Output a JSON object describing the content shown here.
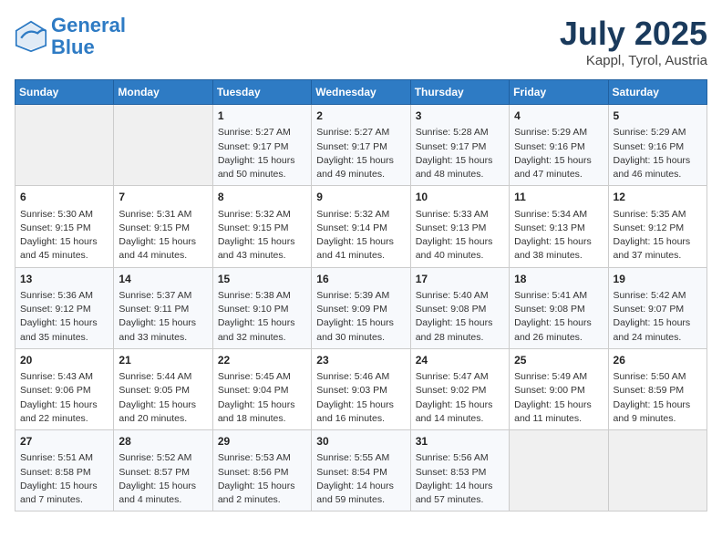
{
  "header": {
    "logo_line1": "General",
    "logo_line2": "Blue",
    "month": "July 2025",
    "location": "Kappl, Tyrol, Austria"
  },
  "weekdays": [
    "Sunday",
    "Monday",
    "Tuesday",
    "Wednesday",
    "Thursday",
    "Friday",
    "Saturday"
  ],
  "weeks": [
    [
      {
        "day": "",
        "sunrise": "",
        "sunset": "",
        "daylight": ""
      },
      {
        "day": "",
        "sunrise": "",
        "sunset": "",
        "daylight": ""
      },
      {
        "day": "1",
        "sunrise": "Sunrise: 5:27 AM",
        "sunset": "Sunset: 9:17 PM",
        "daylight": "Daylight: 15 hours and 50 minutes."
      },
      {
        "day": "2",
        "sunrise": "Sunrise: 5:27 AM",
        "sunset": "Sunset: 9:17 PM",
        "daylight": "Daylight: 15 hours and 49 minutes."
      },
      {
        "day": "3",
        "sunrise": "Sunrise: 5:28 AM",
        "sunset": "Sunset: 9:17 PM",
        "daylight": "Daylight: 15 hours and 48 minutes."
      },
      {
        "day": "4",
        "sunrise": "Sunrise: 5:29 AM",
        "sunset": "Sunset: 9:16 PM",
        "daylight": "Daylight: 15 hours and 47 minutes."
      },
      {
        "day": "5",
        "sunrise": "Sunrise: 5:29 AM",
        "sunset": "Sunset: 9:16 PM",
        "daylight": "Daylight: 15 hours and 46 minutes."
      }
    ],
    [
      {
        "day": "6",
        "sunrise": "Sunrise: 5:30 AM",
        "sunset": "Sunset: 9:15 PM",
        "daylight": "Daylight: 15 hours and 45 minutes."
      },
      {
        "day": "7",
        "sunrise": "Sunrise: 5:31 AM",
        "sunset": "Sunset: 9:15 PM",
        "daylight": "Daylight: 15 hours and 44 minutes."
      },
      {
        "day": "8",
        "sunrise": "Sunrise: 5:32 AM",
        "sunset": "Sunset: 9:15 PM",
        "daylight": "Daylight: 15 hours and 43 minutes."
      },
      {
        "day": "9",
        "sunrise": "Sunrise: 5:32 AM",
        "sunset": "Sunset: 9:14 PM",
        "daylight": "Daylight: 15 hours and 41 minutes."
      },
      {
        "day": "10",
        "sunrise": "Sunrise: 5:33 AM",
        "sunset": "Sunset: 9:13 PM",
        "daylight": "Daylight: 15 hours and 40 minutes."
      },
      {
        "day": "11",
        "sunrise": "Sunrise: 5:34 AM",
        "sunset": "Sunset: 9:13 PM",
        "daylight": "Daylight: 15 hours and 38 minutes."
      },
      {
        "day": "12",
        "sunrise": "Sunrise: 5:35 AM",
        "sunset": "Sunset: 9:12 PM",
        "daylight": "Daylight: 15 hours and 37 minutes."
      }
    ],
    [
      {
        "day": "13",
        "sunrise": "Sunrise: 5:36 AM",
        "sunset": "Sunset: 9:12 PM",
        "daylight": "Daylight: 15 hours and 35 minutes."
      },
      {
        "day": "14",
        "sunrise": "Sunrise: 5:37 AM",
        "sunset": "Sunset: 9:11 PM",
        "daylight": "Daylight: 15 hours and 33 minutes."
      },
      {
        "day": "15",
        "sunrise": "Sunrise: 5:38 AM",
        "sunset": "Sunset: 9:10 PM",
        "daylight": "Daylight: 15 hours and 32 minutes."
      },
      {
        "day": "16",
        "sunrise": "Sunrise: 5:39 AM",
        "sunset": "Sunset: 9:09 PM",
        "daylight": "Daylight: 15 hours and 30 minutes."
      },
      {
        "day": "17",
        "sunrise": "Sunrise: 5:40 AM",
        "sunset": "Sunset: 9:08 PM",
        "daylight": "Daylight: 15 hours and 28 minutes."
      },
      {
        "day": "18",
        "sunrise": "Sunrise: 5:41 AM",
        "sunset": "Sunset: 9:08 PM",
        "daylight": "Daylight: 15 hours and 26 minutes."
      },
      {
        "day": "19",
        "sunrise": "Sunrise: 5:42 AM",
        "sunset": "Sunset: 9:07 PM",
        "daylight": "Daylight: 15 hours and 24 minutes."
      }
    ],
    [
      {
        "day": "20",
        "sunrise": "Sunrise: 5:43 AM",
        "sunset": "Sunset: 9:06 PM",
        "daylight": "Daylight: 15 hours and 22 minutes."
      },
      {
        "day": "21",
        "sunrise": "Sunrise: 5:44 AM",
        "sunset": "Sunset: 9:05 PM",
        "daylight": "Daylight: 15 hours and 20 minutes."
      },
      {
        "day": "22",
        "sunrise": "Sunrise: 5:45 AM",
        "sunset": "Sunset: 9:04 PM",
        "daylight": "Daylight: 15 hours and 18 minutes."
      },
      {
        "day": "23",
        "sunrise": "Sunrise: 5:46 AM",
        "sunset": "Sunset: 9:03 PM",
        "daylight": "Daylight: 15 hours and 16 minutes."
      },
      {
        "day": "24",
        "sunrise": "Sunrise: 5:47 AM",
        "sunset": "Sunset: 9:02 PM",
        "daylight": "Daylight: 15 hours and 14 minutes."
      },
      {
        "day": "25",
        "sunrise": "Sunrise: 5:49 AM",
        "sunset": "Sunset: 9:00 PM",
        "daylight": "Daylight: 15 hours and 11 minutes."
      },
      {
        "day": "26",
        "sunrise": "Sunrise: 5:50 AM",
        "sunset": "Sunset: 8:59 PM",
        "daylight": "Daylight: 15 hours and 9 minutes."
      }
    ],
    [
      {
        "day": "27",
        "sunrise": "Sunrise: 5:51 AM",
        "sunset": "Sunset: 8:58 PM",
        "daylight": "Daylight: 15 hours and 7 minutes."
      },
      {
        "day": "28",
        "sunrise": "Sunrise: 5:52 AM",
        "sunset": "Sunset: 8:57 PM",
        "daylight": "Daylight: 15 hours and 4 minutes."
      },
      {
        "day": "29",
        "sunrise": "Sunrise: 5:53 AM",
        "sunset": "Sunset: 8:56 PM",
        "daylight": "Daylight: 15 hours and 2 minutes."
      },
      {
        "day": "30",
        "sunrise": "Sunrise: 5:55 AM",
        "sunset": "Sunset: 8:54 PM",
        "daylight": "Daylight: 14 hours and 59 minutes."
      },
      {
        "day": "31",
        "sunrise": "Sunrise: 5:56 AM",
        "sunset": "Sunset: 8:53 PM",
        "daylight": "Daylight: 14 hours and 57 minutes."
      },
      {
        "day": "",
        "sunrise": "",
        "sunset": "",
        "daylight": ""
      },
      {
        "day": "",
        "sunrise": "",
        "sunset": "",
        "daylight": ""
      }
    ]
  ]
}
